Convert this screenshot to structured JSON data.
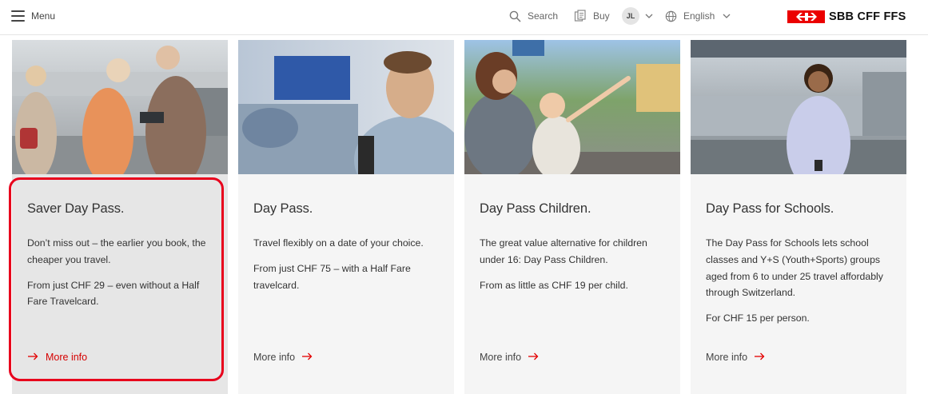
{
  "header": {
    "menu_label": "Menu",
    "search_label": "Search",
    "buy_label": "Buy",
    "user_initials": "JL",
    "language_label": "English",
    "logo_text": "SBB CFF FFS",
    "brand_color": "#eb0000"
  },
  "cards": [
    {
      "title": "Saver Day Pass.",
      "paragraphs": [
        "Don’t miss out – the earlier you book, the cheaper you travel.",
        "From just CHF 29 – even without a Half Fare Travelcard."
      ],
      "more_label": "More info",
      "highlighted": true
    },
    {
      "title": "Day Pass.",
      "paragraphs": [
        "Travel flexibly on a date of your choice.",
        "From just CHF 75 – with a Half Fare travelcard."
      ],
      "more_label": "More info"
    },
    {
      "title": "Day Pass Children.",
      "paragraphs": [
        "The great value alternative for children under 16: Day Pass Children.",
        "From as little as CHF 19 per child."
      ],
      "more_label": "More info"
    },
    {
      "title": "Day Pass for Schools.",
      "paragraphs": [
        "The Day Pass for Schools lets school classes and Y+S (Youth+Sports) groups aged from 6 to under 25 travel affordably through Switzerland.",
        "For CHF 15 per person."
      ],
      "more_label": "More info"
    }
  ],
  "icons": {
    "menu": "hamburger-icon",
    "search": "search-icon",
    "buy": "ticket-icon",
    "chevron": "chevron-down-icon",
    "language": "globe-icon",
    "more": "arrow-right-icon"
  },
  "colors": {
    "accent": "#eb0000",
    "highlight_outline": "#e8001c",
    "card_bg": "#f5f5f5",
    "card_active_bg": "#e6e6e6"
  }
}
